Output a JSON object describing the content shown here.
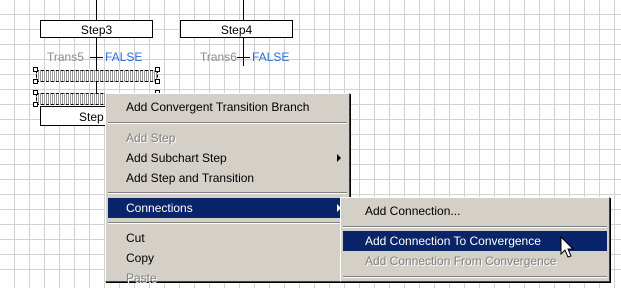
{
  "diagram": {
    "steps": [
      "Step3",
      "Step4",
      "Step"
    ],
    "transitions": [
      {
        "name": "Trans5",
        "condition": "FALSE"
      },
      {
        "name": "Trans6",
        "condition": "FALSE"
      }
    ]
  },
  "context_menu": {
    "items": [
      {
        "label": "Add Convergent Transition Branch",
        "enabled": true
      },
      {
        "label": "Add Step",
        "enabled": false
      },
      {
        "label": "Add Subchart Step",
        "enabled": true,
        "submenu": true
      },
      {
        "label": "Add Step and Transition",
        "enabled": true
      },
      {
        "label": "Connections",
        "enabled": true,
        "submenu": true,
        "highlighted": true
      },
      {
        "label": "Cut",
        "enabled": true
      },
      {
        "label": "Copy",
        "enabled": true
      },
      {
        "label": "Paste",
        "enabled": false
      }
    ]
  },
  "submenu": {
    "items": [
      {
        "label": "Add Connection...",
        "enabled": true
      },
      {
        "label": "Add Connection To Convergence",
        "enabled": true,
        "highlighted": true
      },
      {
        "label": "Add Connection From Convergence",
        "enabled": false
      }
    ]
  },
  "colors": {
    "menu_bg": "#d4d0c8",
    "highlight": "#0a246a",
    "condition_text": "#2d6fd8",
    "grid": "#d2d2d2"
  }
}
